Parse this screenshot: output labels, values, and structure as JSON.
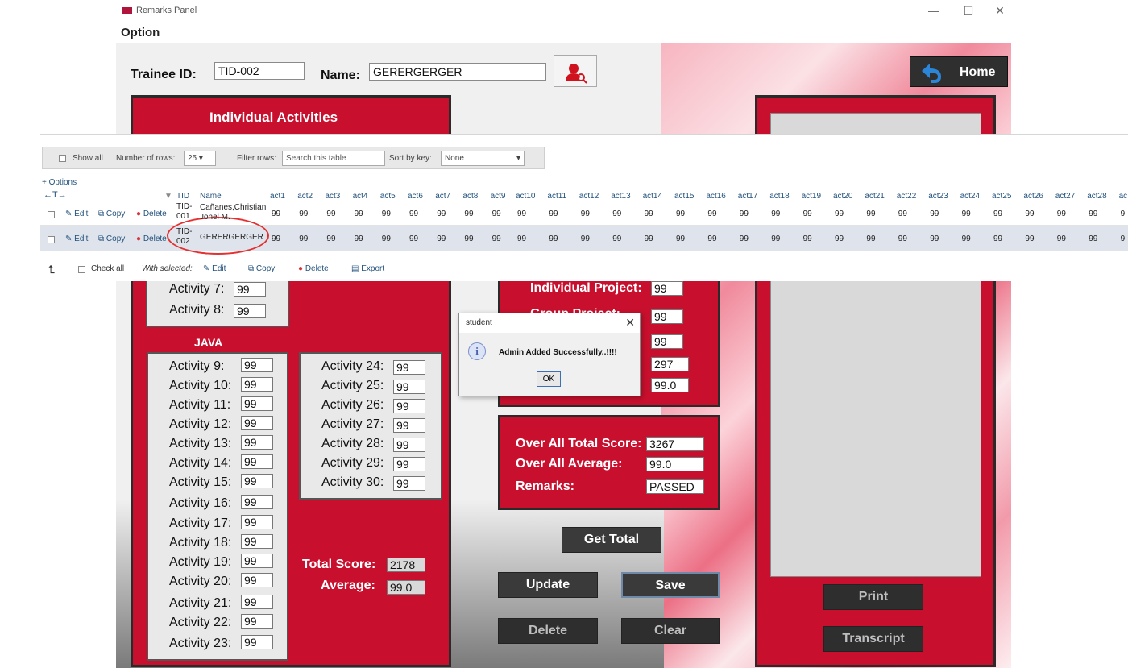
{
  "window": {
    "title": "Remarks Panel",
    "menu": "Option",
    "controls": [
      "—",
      "☐",
      "✕"
    ]
  },
  "form": {
    "trainee_id_label": "Trainee ID:",
    "trainee_id_value": "TID-002",
    "name_label": "Name:",
    "name_value": "GERERGERGER",
    "home_label": "Home"
  },
  "individual": {
    "title": "Individual Activities",
    "visible_activities": [
      {
        "label": "Activity 7:",
        "value": "99"
      },
      {
        "label": "Activity 8:",
        "value": "99"
      }
    ],
    "java_label": "JAVA",
    "java_col1": [
      {
        "label": "Activity 9:",
        "value": "99"
      },
      {
        "label": "Activity 10:",
        "value": "99"
      },
      {
        "label": "Activity 11:",
        "value": "99"
      },
      {
        "label": "Activity 12:",
        "value": "99"
      },
      {
        "label": "Activity 13:",
        "value": "99"
      },
      {
        "label": "Activity 14:",
        "value": "99"
      },
      {
        "label": "Activity 15:",
        "value": "99"
      },
      {
        "label": "Activity 16:",
        "value": "99"
      },
      {
        "label": "Activity 17:",
        "value": "99"
      },
      {
        "label": "Activity 18:",
        "value": "99"
      },
      {
        "label": "Activity 19:",
        "value": "99"
      },
      {
        "label": "Activity 20:",
        "value": "99"
      },
      {
        "label": "Activity 21:",
        "value": "99"
      },
      {
        "label": "Activity 22:",
        "value": "99"
      },
      {
        "label": "Activity 23:",
        "value": "99"
      }
    ],
    "java_col2": [
      {
        "label": "Activity 24:",
        "value": "99"
      },
      {
        "label": "Activity 25:",
        "value": "99"
      },
      {
        "label": "Activity 26:",
        "value": "99"
      },
      {
        "label": "Activity 27:",
        "value": "99"
      },
      {
        "label": "Activity 28:",
        "value": "99"
      },
      {
        "label": "Activity 29:",
        "value": "99"
      },
      {
        "label": "Activity 30:",
        "value": "99"
      }
    ],
    "total_label": "Total Score:",
    "total_value": "2178",
    "average_label": "Average:",
    "average_value": "99.0"
  },
  "projects": {
    "individual_project_label": "Individual Project:",
    "individual_project_value": "99",
    "group_project_label": "Group Project:",
    "group_project_value": "99",
    "third_value": "99",
    "total_value": "297",
    "average_value": "99.0"
  },
  "overall": {
    "total_label": "Over All Total Score:",
    "total_value": "3267",
    "average_label": "Over All Average:",
    "average_value": "99.0",
    "remarks_label": "Remarks:",
    "remarks_value": "PASSED"
  },
  "buttons": {
    "get_total": "Get Total",
    "update": "Update",
    "save": "Save",
    "delete": "Delete",
    "clear": "Clear",
    "print": "Print",
    "transcript": "Transcript"
  },
  "pma": {
    "show_all": "Show all",
    "rows_label": "Number of rows:",
    "rows_value": "25",
    "filter_label": "Filter rows:",
    "filter_placeholder": "Search this table",
    "sort_label": "Sort by key:",
    "sort_value": "None",
    "options_link": "+ Options",
    "arrows": "←T→",
    "columns": [
      "TID",
      "Name",
      "act1",
      "act2",
      "act3",
      "act4",
      "act5",
      "act6",
      "act7",
      "act8",
      "act9",
      "act10",
      "act11",
      "act12",
      "act13",
      "act14",
      "act15",
      "act16",
      "act17",
      "act18",
      "act19",
      "act20",
      "act21",
      "act22",
      "act23",
      "act24",
      "act25",
      "act26",
      "act27",
      "act28",
      "ac"
    ],
    "row_actions": {
      "edit": "Edit",
      "copy": "Copy",
      "delete": "Delete"
    },
    "rows": [
      {
        "tid_line1": "TID-",
        "tid_line2": "001",
        "name_line1": "Cañanes,Christian",
        "name_line2": "Jonel M."
      },
      {
        "tid_line1": "TID-",
        "tid_line2": "002",
        "name_line1": "GERERGERGER",
        "name_line2": ""
      }
    ],
    "cell_value": "99",
    "last_cell": "9",
    "footer": {
      "check_all": "Check all",
      "with_selected": "With selected:",
      "edit": "Edit",
      "copy": "Copy",
      "delete": "Delete",
      "export": "Export"
    }
  },
  "dialog": {
    "title": "student",
    "message": "Admin Added Successfully..!!!!",
    "ok": "OK"
  }
}
